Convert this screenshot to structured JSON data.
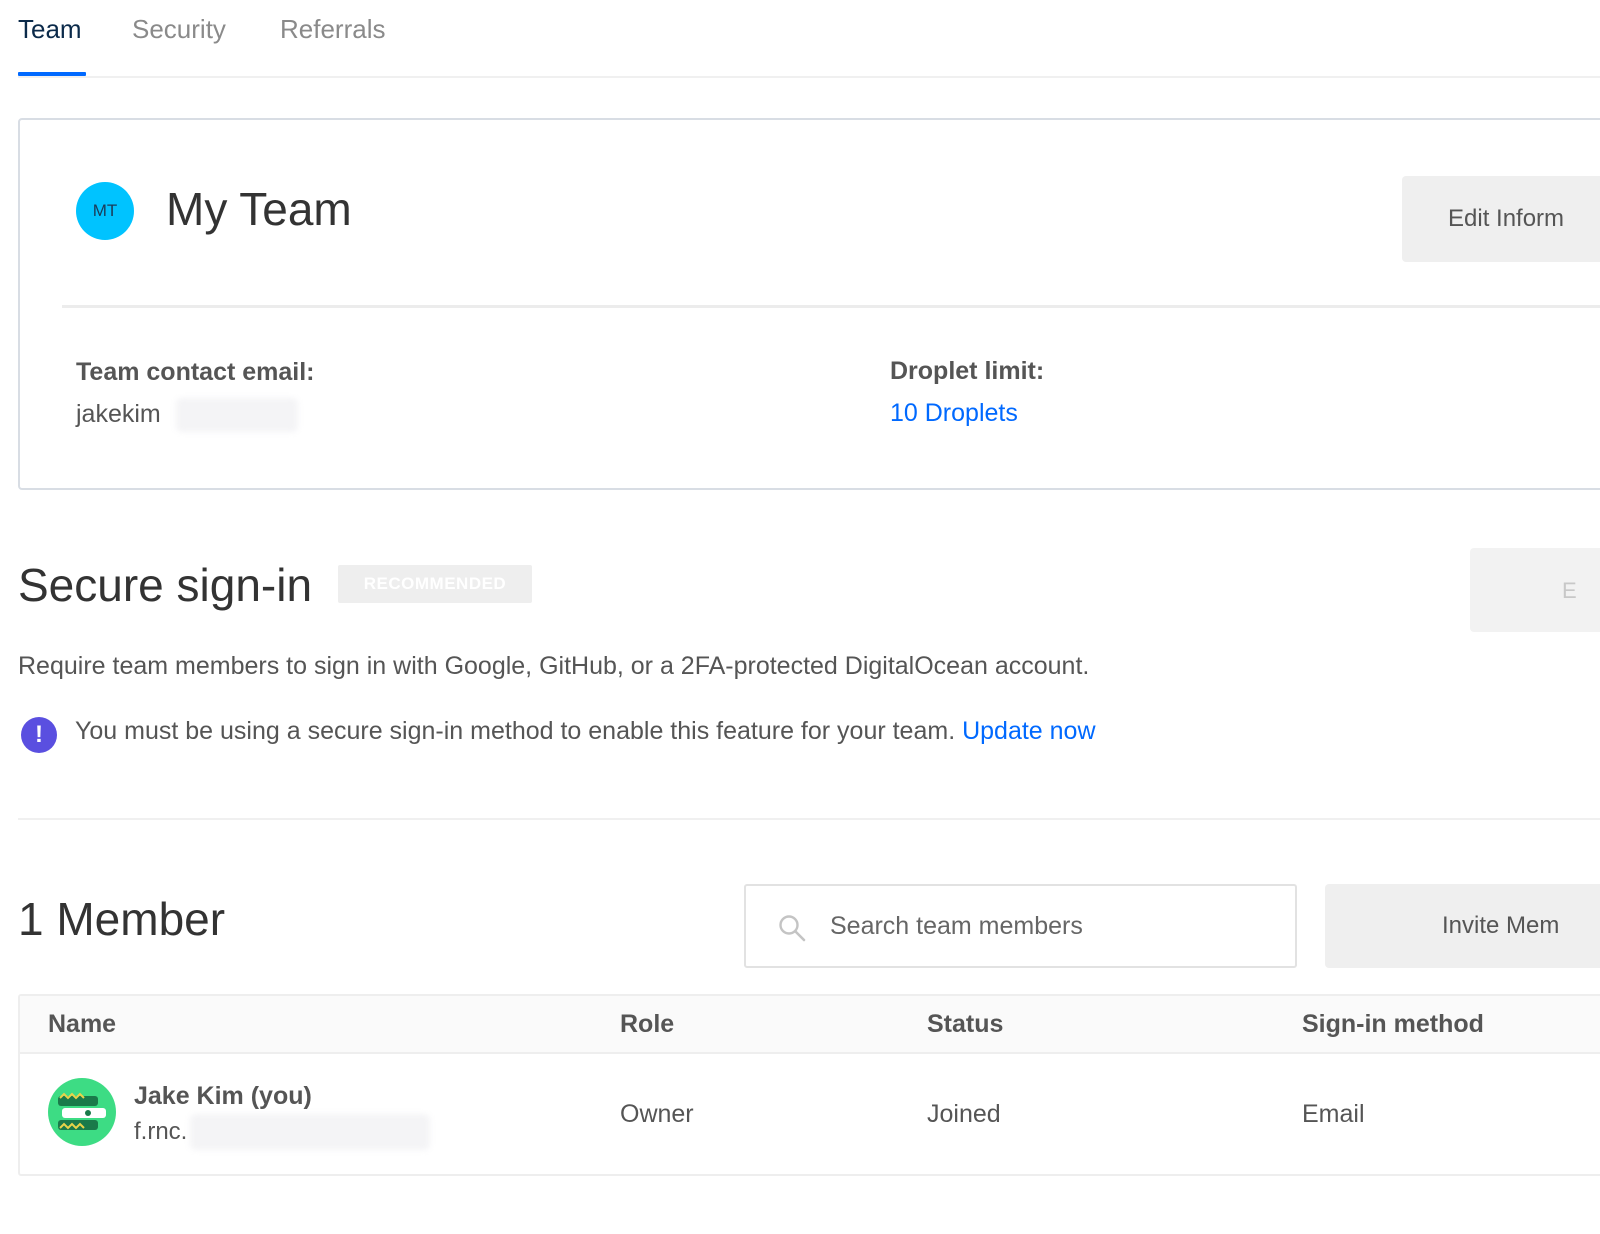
{
  "tabs": [
    {
      "label": "Team",
      "active": true
    },
    {
      "label": "Security",
      "active": false
    },
    {
      "label": "Referrals",
      "active": false
    }
  ],
  "team": {
    "initials": "MT",
    "name": "My Team",
    "edit_button": "Edit Inform",
    "contact_email_label": "Team contact email:",
    "contact_email_value": "jakekim",
    "droplet_limit_label": "Droplet limit:",
    "droplet_limit_value": "10 Droplets"
  },
  "secure_signin": {
    "title": "Secure sign-in",
    "badge": "RECOMMENDED",
    "enable_button": "E",
    "description": "Require team members to sign in with Google, GitHub, or a 2FA-protected DigitalOcean account.",
    "notice_text": "You must be using a secure sign-in method to enable this feature for your team.",
    "notice_link": "Update now"
  },
  "members": {
    "count_title": "1 Member",
    "search_placeholder": "Search team members",
    "invite_button": "Invite Mem",
    "columns": [
      "Name",
      "Role",
      "Status",
      "Sign-in method"
    ],
    "rows": [
      {
        "name": "Jake Kim (you)",
        "email": "f.rnc.",
        "role": "Owner",
        "status": "Joined",
        "signin_method": "Email"
      }
    ]
  },
  "colors": {
    "accent": "#0069ff",
    "team_avatar": "#00c3ff",
    "notice_icon": "#5a4fe0",
    "member_avatar": "#3ddc84"
  }
}
